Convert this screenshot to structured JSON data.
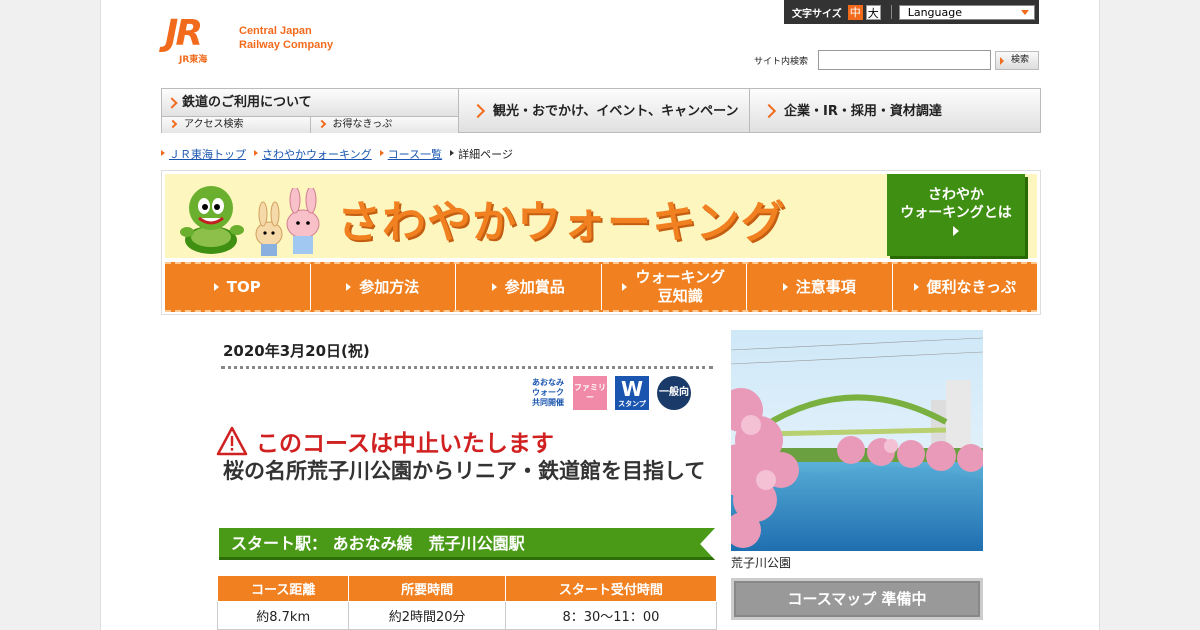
{
  "header": {
    "logo_mark": "JR",
    "logo_sub": "JR東海",
    "logo_text_line1": "Central Japan",
    "logo_text_line2": "Railway Company",
    "font_size_label": "文字サイズ",
    "font_size_mid": "中",
    "font_size_big": "大",
    "language_label": "Language",
    "search_label": "サイト内検索",
    "search_placeholder": "",
    "search_button": "検索"
  },
  "gnav": {
    "main1": "鉄道のご利用について",
    "sub1": "アクセス検索",
    "sub2": "お得なきっぷ",
    "item2": "観光・おでかけ、イベント、キャンペーン",
    "item3": "企業・IR・採用・資材調達"
  },
  "breadcrumb": {
    "c1": "ＪＲ東海トップ",
    "c2": "さわやかウォーキング",
    "c3": "コース一覧",
    "c4": "詳細ページ"
  },
  "banner": {
    "title": "さわやかウォーキング",
    "about_line1": "さわやか",
    "about_line2": "ウォーキングとは",
    "nav": {
      "top": "TOP",
      "how": "参加方法",
      "prize": "参加賞品",
      "knowledge_line1": "ウォーキング",
      "knowledge_line2": "豆知識",
      "notes": "注意事項",
      "tickets": "便利なきっぷ"
    }
  },
  "event": {
    "date": "2020年3月20日(祝)",
    "badge1_line1": "あおなみウォーク",
    "badge1_line2": "共同開催",
    "badge2": "ファミリー",
    "badge3_main": "W",
    "badge3_sub": "スタンプ",
    "badge4": "一般向",
    "cancel_notice": "このコースは中止いたします",
    "title": "桜の名所荒子川公園からリニア・鉄道館を目指して",
    "start_label": "スタート駅：",
    "start_station": "あおなみ線　荒子川公園駅",
    "table": {
      "headers": [
        "コース距離",
        "所要時間",
        "スタート受付時間"
      ],
      "values": [
        "約8.7km",
        "約2時間20分",
        "8：30～11：00"
      ]
    }
  },
  "side": {
    "photo_caption": "荒子川公園",
    "map_button": "コースマップ 準備中"
  },
  "colors": {
    "brand_orange": "#f26b1d",
    "walking_orange": "#f08020",
    "walking_green": "#4a9a18",
    "cancel_red": "#d02020"
  }
}
